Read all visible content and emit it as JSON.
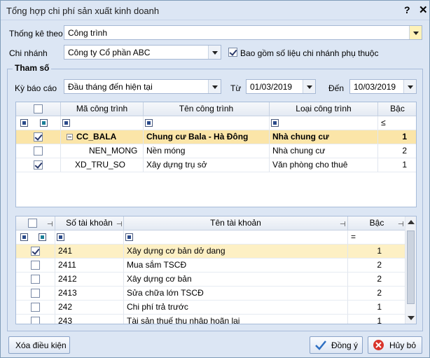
{
  "window": {
    "title": "Tổng hợp chi phí sản xuất kinh doanh",
    "help": "?",
    "close": "✕"
  },
  "form": {
    "thong_ke_label": "Thống kê theo",
    "thong_ke_value": "Công trình",
    "chi_nhanh_label": "Chi nhánh",
    "chi_nhanh_value": "Công ty Cổ phần ABC",
    "bao_gom_label": "Bao gồm số liệu chi nhánh phụ thuộc",
    "bao_gom_checked": true
  },
  "tham_so": {
    "title": "Tham số",
    "ky_bao_cao_label": "Kỳ báo cáo",
    "ky_bao_cao_value": "Đầu tháng đến hiện tại",
    "tu_label": "Từ",
    "tu_value": "01/03/2019",
    "den_label": "Đến",
    "den_value": "10/03/2019"
  },
  "cong_trinh_grid": {
    "columns": [
      "Mã công trình",
      "Tên công trình",
      "Loại công trình",
      "Bậc"
    ],
    "filter_op": "≤",
    "rows": [
      {
        "checked": true,
        "code": "CC_BALA",
        "name": "Chung cư Bala - Hà Đông",
        "type": "Nhà chung cư",
        "level": "1",
        "parent": true
      },
      {
        "checked": false,
        "code": "NEN_MONG",
        "name": "Nền móng",
        "type": "Nhà chung cư",
        "level": "2",
        "parent": false
      },
      {
        "checked": true,
        "code": "XD_TRU_SO",
        "name": "Xây dựng trụ sở",
        "type": "Văn phòng cho thuê",
        "level": "1",
        "parent": false
      }
    ]
  },
  "tai_khoan_grid": {
    "columns": [
      "Số tài khoản",
      "Tên tài khoản",
      "Bậc"
    ],
    "filter_op": "=",
    "rows": [
      {
        "checked": true,
        "code": "241",
        "name": "Xây dựng cơ bản dở dang",
        "level": "1"
      },
      {
        "checked": false,
        "code": "2411",
        "name": "Mua sắm TSCĐ",
        "level": "2"
      },
      {
        "checked": false,
        "code": "2412",
        "name": "Xây dựng cơ bản",
        "level": "2"
      },
      {
        "checked": false,
        "code": "2413",
        "name": "Sửa chữa lớn TSCĐ",
        "level": "2"
      },
      {
        "checked": false,
        "code": "242",
        "name": "Chi phí trả trước",
        "level": "1"
      },
      {
        "checked": false,
        "code": "243",
        "name": "Tài sản thuế thu nhập hoãn lại",
        "level": "1"
      }
    ]
  },
  "footer": {
    "clear_label": "Xóa điều kiện",
    "ok_label": "Đồng ý",
    "cancel_label": "Hủy bỏ"
  }
}
